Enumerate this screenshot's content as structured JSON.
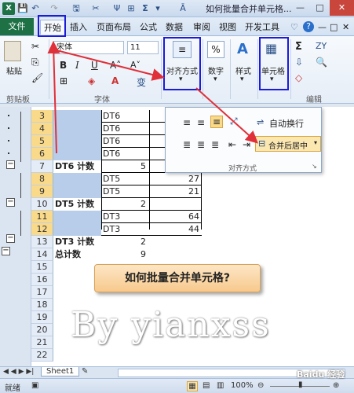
{
  "titlebar": {
    "title": "如何批量合并单元格...",
    "qat": [
      "X",
      "💾",
      "↶",
      "↷",
      "🖫",
      "✂",
      "Ψ",
      "⊞",
      "Σ",
      "▾",
      "Ā"
    ],
    "win_min": "—",
    "win_max": "□",
    "win_close": "✕"
  },
  "tabs": {
    "file": "文件",
    "items": [
      "开始",
      "插入",
      "页面布局",
      "公式",
      "数据",
      "审阅",
      "视图",
      "开发工具"
    ],
    "right_icons": [
      "♡",
      "?",
      "—",
      "□",
      "✕"
    ]
  },
  "ribbon": {
    "paste": "粘贴",
    "clipboard_label": "剪贴板",
    "font_name": "宋体",
    "font_size": "11",
    "bold": "B",
    "italic": "I",
    "underline": "U",
    "font_label": "字体",
    "wen": "变",
    "align_label": "对齐方式",
    "number_label": "数字",
    "style_label": "样式",
    "cells_label": "单元格",
    "edit_label": "编辑",
    "percent": "%",
    "sigma": "Σ",
    "sort": "ZY"
  },
  "grid": {
    "rows": [
      {
        "num": "3",
        "label": "",
        "a": "DT6",
        "b": "",
        "c": ""
      },
      {
        "num": "4",
        "label": "",
        "a": "DT6",
        "b": "",
        "c": ""
      },
      {
        "num": "5",
        "label": "",
        "a": "DT6",
        "b": "",
        "c": ""
      },
      {
        "num": "6",
        "label": "",
        "a": "DT6",
        "b": "",
        "c": ""
      },
      {
        "num": "7",
        "label": "DT6 计数",
        "a": "",
        "b": "5",
        "c": ""
      },
      {
        "num": "8",
        "label": "",
        "a": "DT5",
        "b": "",
        "c": "27"
      },
      {
        "num": "9",
        "label": "",
        "a": "DT5",
        "b": "",
        "c": "21"
      },
      {
        "num": "10",
        "label": "DT5 计数",
        "a": "",
        "b": "2",
        "c": ""
      },
      {
        "num": "11",
        "label": "",
        "a": "DT3",
        "b": "",
        "c": "64"
      },
      {
        "num": "12",
        "label": "",
        "a": "DT3",
        "b": "",
        "c": "44"
      },
      {
        "num": "13",
        "label": "DT3 计数",
        "a": "",
        "b": "2",
        "c": ""
      },
      {
        "num": "14",
        "label": "总计数",
        "a": "",
        "b": "9",
        "c": ""
      },
      {
        "num": "15",
        "label": "",
        "a": "",
        "b": "",
        "c": ""
      },
      {
        "num": "16",
        "label": "",
        "a": "",
        "b": "",
        "c": ""
      },
      {
        "num": "17",
        "label": "",
        "a": "",
        "b": "",
        "c": ""
      },
      {
        "num": "18",
        "label": "",
        "a": "",
        "b": "",
        "c": ""
      },
      {
        "num": "19",
        "label": "",
        "a": "",
        "b": "",
        "c": ""
      },
      {
        "num": "20",
        "label": "",
        "a": "",
        "b": "",
        "c": ""
      },
      {
        "num": "21",
        "label": "",
        "a": "",
        "b": "",
        "c": ""
      },
      {
        "num": "22",
        "label": "",
        "a": "",
        "b": "",
        "c": ""
      }
    ]
  },
  "panel": {
    "wrap": "自动换行",
    "merge": "合并后居中",
    "footer": "对齐方式"
  },
  "callout": "如何批量合并单元格?",
  "watermark": "By yianxss",
  "sheetbar": {
    "tab": "Sheet1",
    "nav": "◀ ◀ ▶ ▶|"
  },
  "status": {
    "ready": "就绪",
    "zoom": "100%",
    "brand": "Baidu 经验"
  },
  "colors": {
    "file_tab": "#1e7145",
    "highlight_box": "#1b1bd9",
    "arrow": "#e0303a",
    "selected_row": "#f9d98a"
  }
}
